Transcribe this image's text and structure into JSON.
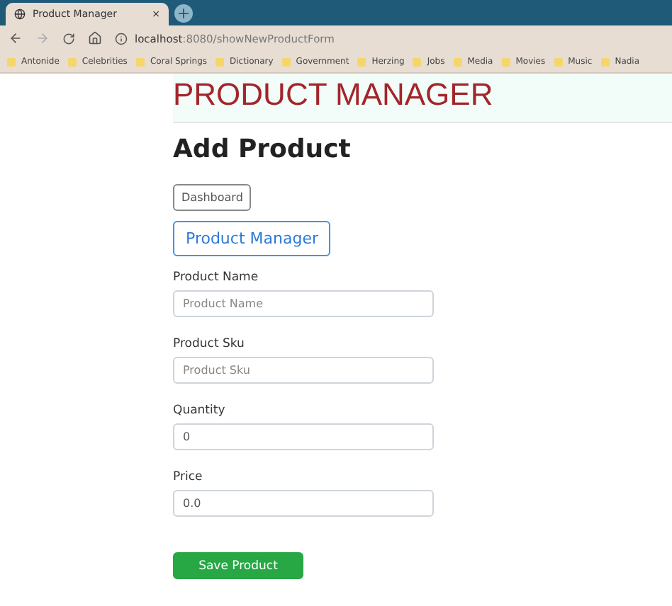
{
  "browser": {
    "tab": {
      "title": "Product Manager",
      "close": "×",
      "new_tab": "+"
    },
    "address_host": "localhost",
    "address_path": ":8080/showNewProductForm",
    "bookmarks": [
      "Antonide",
      "Celebrities",
      "Coral Springs",
      "Dictionary",
      "Government",
      "Herzing",
      "Jobs",
      "Media",
      "Movies",
      "Music",
      "Nadia"
    ]
  },
  "header": {
    "title": "PRODUCT MANAGER"
  },
  "heading": "Add Product",
  "nav_buttons": [
    {
      "label": "Dashboard",
      "kind": "small"
    },
    {
      "label": "Product Manager",
      "kind": "primary"
    }
  ],
  "fields": [
    {
      "label": "Product Name",
      "placeholder": "Product Name"
    },
    {
      "label": "Product Sku",
      "placeholder": "Product Sku"
    },
    {
      "label": "Quantity",
      "value": "0"
    },
    {
      "label": "Price",
      "value": "0.0"
    }
  ],
  "submit": "Save Product"
}
